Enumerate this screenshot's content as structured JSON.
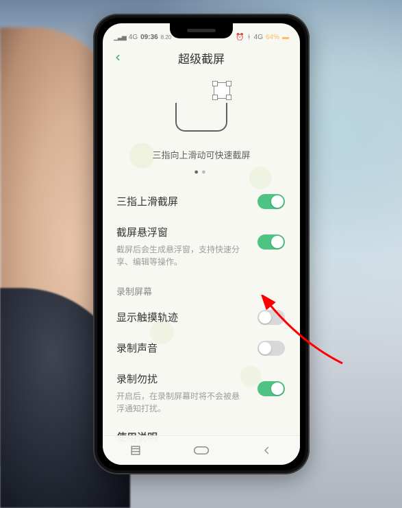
{
  "status": {
    "network": "4G",
    "signal": "⋮⋮",
    "time": "09:36",
    "subtime": "8.20",
    "alarm_icon": "alarm",
    "bt_icon": "bt",
    "net2": "4G",
    "battery_pct": "64%"
  },
  "header": {
    "title": "超级截屏"
  },
  "hero": {
    "caption": "三指向上滑动可快速截屏",
    "page_index": 0,
    "page_count": 2
  },
  "rows": {
    "three_finger": {
      "label": "三指上滑截屏",
      "on": true
    },
    "float_window": {
      "label": "截屏悬浮窗",
      "sub": "截屏后会生成悬浮窗，支持快速分享、编辑等操作。",
      "on": true
    }
  },
  "record_section": "录制屏幕",
  "record": {
    "show_touch": {
      "label": "显示触摸轨迹",
      "on": false
    },
    "record_audio": {
      "label": "录制声音",
      "on": false
    },
    "dnd": {
      "label": "录制勿扰",
      "sub": "开启后，在录制屏幕时将不会被悬浮通知打扰。",
      "on": true
    }
  },
  "cutoff_label": "使用说明"
}
